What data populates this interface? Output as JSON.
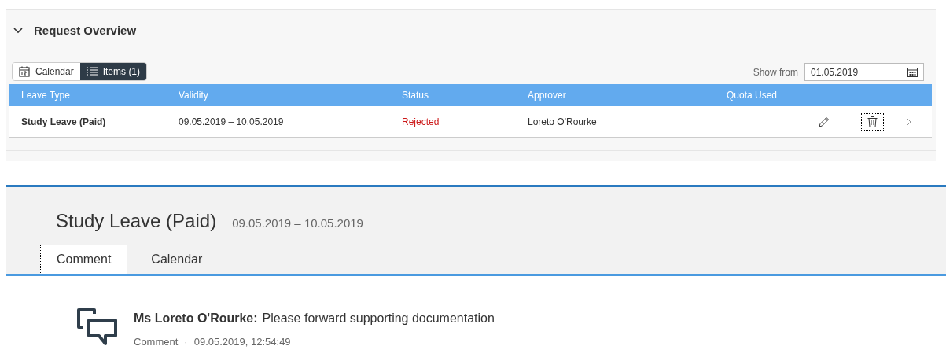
{
  "section": {
    "title": "Request Overview",
    "expanded": true
  },
  "view_toggle": [
    {
      "label": "Calendar",
      "kind": "calendar",
      "selected": false
    },
    {
      "label": "Items (1)",
      "kind": "list",
      "selected": true
    }
  ],
  "show_from": {
    "label": "Show from",
    "value": "01.05.2019"
  },
  "table": {
    "columns": [
      "Leave Type",
      "Validity",
      "Status",
      "Approver",
      "Quota Used"
    ],
    "rows": [
      {
        "leave_type": "Study Leave (Paid)",
        "validity": "09.05.2019 – 10.05.2019",
        "status": "Rejected",
        "approver": "Loreto O'Rourke"
      }
    ]
  },
  "detail": {
    "title": "Study Leave (Paid)",
    "dates": "09.05.2019 – 10.05.2019",
    "tabs": [
      {
        "label": "Comment",
        "selected": true
      },
      {
        "label": "Calendar",
        "selected": false
      }
    ],
    "comments": [
      {
        "author": "Ms Loreto O'Rourke:",
        "text": "Please forward supporting documentation",
        "type": "Comment",
        "separator": "·",
        "timestamp": "09.05.2019, 12:54:49"
      }
    ]
  }
}
